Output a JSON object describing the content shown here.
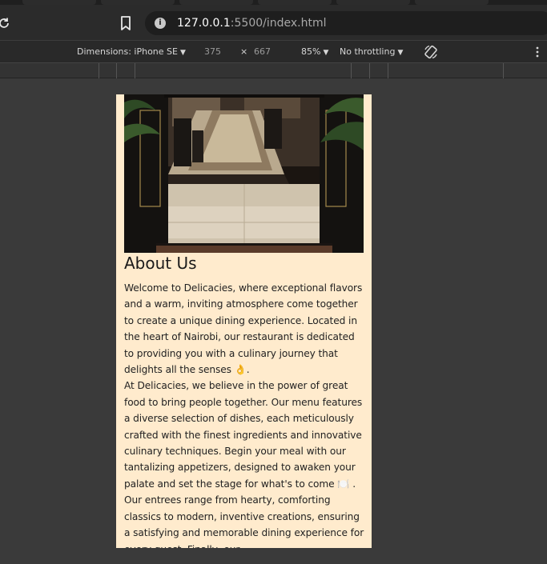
{
  "browser": {
    "url_host": "127.0.0.1",
    "url_rest": ":5500/index.html"
  },
  "device_toolbar": {
    "dimensions_label": "Dimensions: iPhone SE",
    "width": "375",
    "times": "×",
    "height": "667",
    "zoom": "85%",
    "throttling": "No throttling"
  },
  "page": {
    "heading": "About Us",
    "paragraph_1": "Welcome to Delicacies, where exceptional flavors and a warm, inviting atmosphere come together to create a unique dining experience. Located in the heart of Nairobi, our restaurant is dedicated to providing you with a culinary journey that delights all the senses 👌.",
    "paragraph_2": "At Delicacies, we believe in the power of great food to bring people together. Our menu features a diverse selection of dishes, each meticulously crafted with the finest ingredients and innovative culinary techniques. Begin your meal with our tantalizing appetizers, designed to awaken your palate and set the stage for what's to come 🍽️ . Our entrees range from hearty, comforting classics to modern, inventive creations, ensuring a satisfying and memorable dining experience for every guest. Finally, our"
  },
  "colors": {
    "page_bg": "#ffebcd",
    "chrome_bg": "#2b2b2b",
    "canvas_bg": "#3a3a3a"
  },
  "icons": {
    "reload": "reload-icon",
    "bookmark": "bookmark-icon",
    "site_info": "info-icon",
    "rotate": "rotate-icon",
    "more": "kebab-menu-icon"
  }
}
